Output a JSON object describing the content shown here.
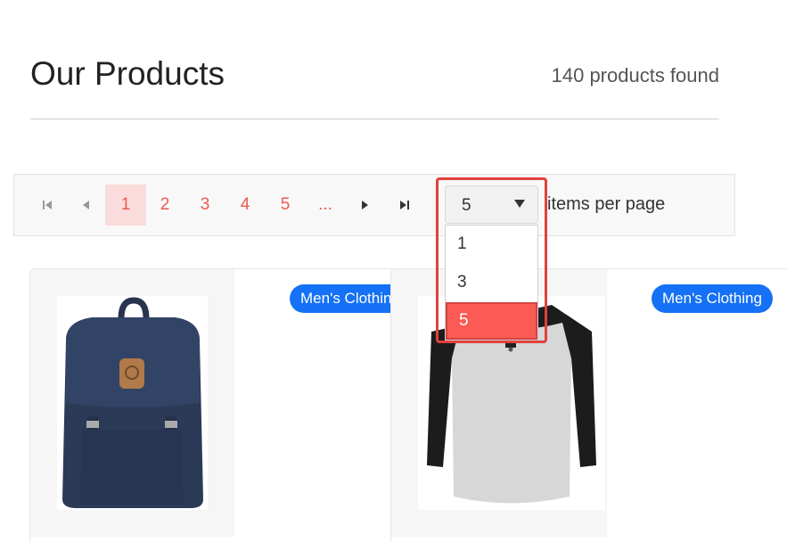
{
  "header": {
    "title": "Our Products",
    "count": "140 products found"
  },
  "pagination": {
    "first_icon": "first-page-icon",
    "prev_icon": "previous-page-icon",
    "next_icon": "next-page-icon",
    "last_icon": "last-page-icon",
    "pages": [
      "1",
      "2",
      "3",
      "4",
      "5",
      "..."
    ],
    "current_page": "1",
    "items_per_page_label": "items per page"
  },
  "per_page_select": {
    "value": "5",
    "options": [
      "1",
      "3",
      "5"
    ],
    "highlight_color": "#fa5b55"
  },
  "products": [
    {
      "category": "Men's Clothing",
      "image": "navy-backpack"
    },
    {
      "category": "Men's Clothing",
      "image": "raglan-shirt"
    }
  ],
  "colors": {
    "accent": "#ee5a50",
    "badge": "#1571f5",
    "annotation": "#e2403d"
  }
}
